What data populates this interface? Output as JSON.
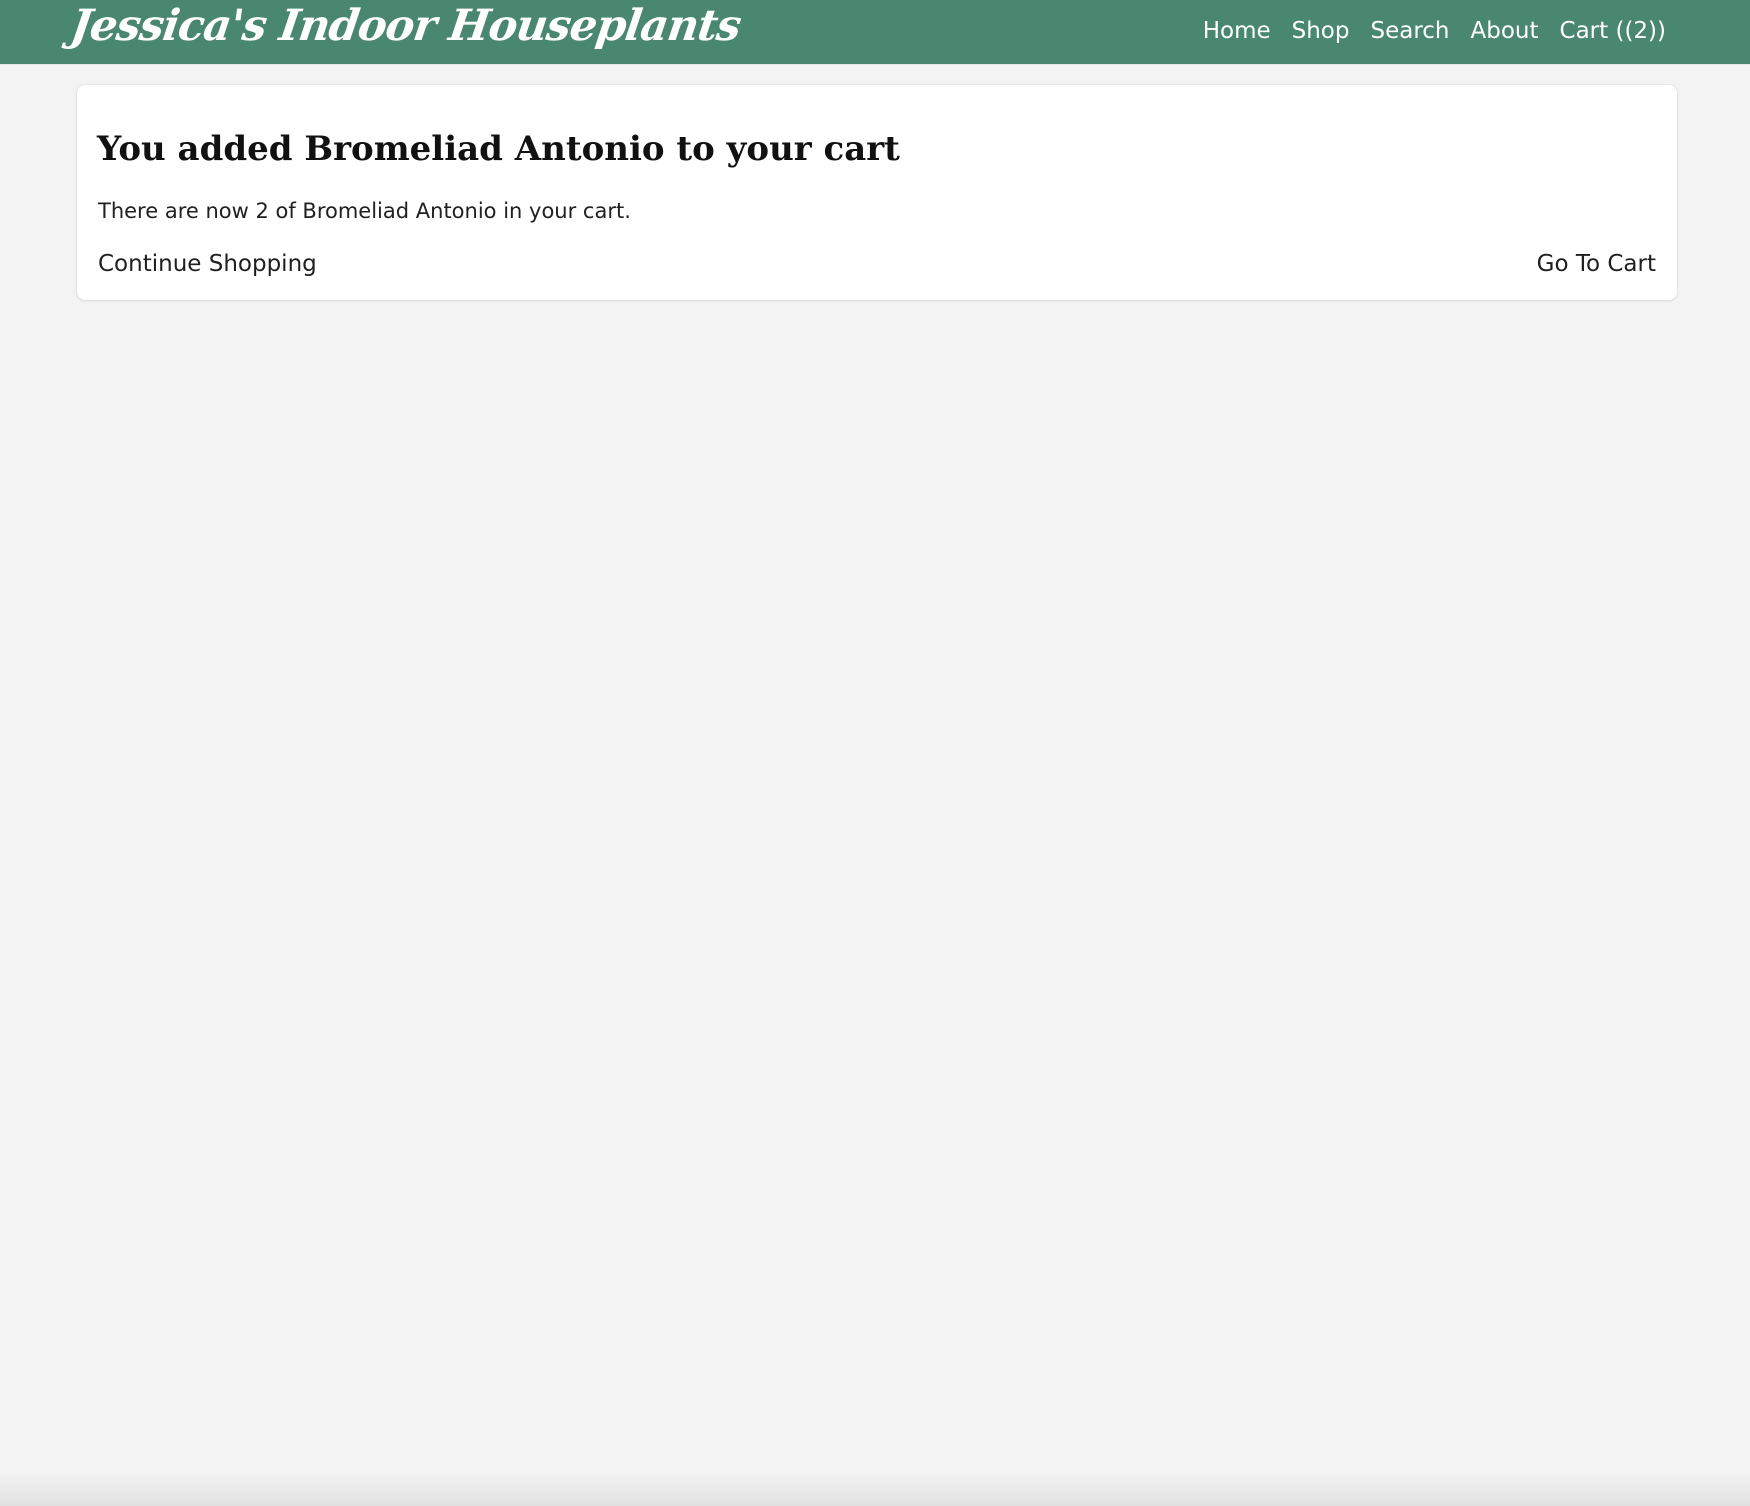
{
  "header": {
    "brand": "Jessica's Indoor Houseplants",
    "nav": [
      {
        "label": "Home"
      },
      {
        "label": "Shop"
      },
      {
        "label": "Search"
      },
      {
        "label": "About"
      },
      {
        "label": "Cart ((2))"
      }
    ],
    "background_color": "#4a8770"
  },
  "cart_notice": {
    "title": "You added Bromeliad Antonio to your cart",
    "message": "There are now 2 of Bromeliad Antonio in your cart.",
    "continue_label": "Continue Shopping",
    "go_to_cart_label": "Go To Cart"
  },
  "page": {
    "background_color": "#f3f3f3",
    "card_color": "#ffffff"
  }
}
